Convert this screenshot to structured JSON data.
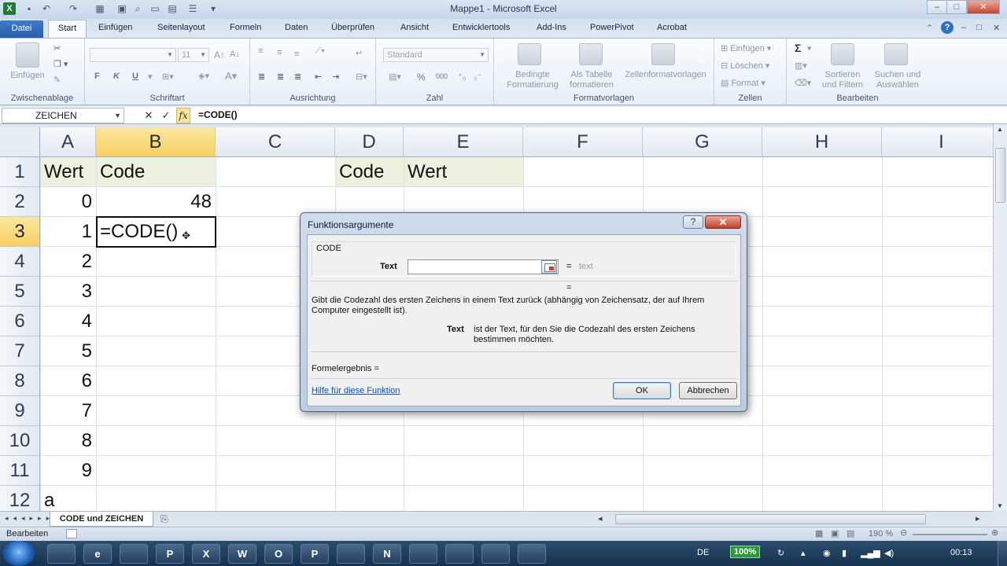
{
  "window": {
    "title": "Mappe1  -  Microsoft Excel",
    "app_icon": "X",
    "controls": {
      "minimize": "–",
      "maximize": "□",
      "close": "✕"
    }
  },
  "ribbon": {
    "tabs": [
      "Datei",
      "Start",
      "Einfügen",
      "Seitenlayout",
      "Formeln",
      "Daten",
      "Überprüfen",
      "Ansicht",
      "Entwicklertools",
      "Add-Ins",
      "PowerPivot",
      "Acrobat"
    ],
    "active_tab": "Start",
    "clipboard": {
      "paste_label": "Einfügen",
      "group_label": "Zwischenablage"
    },
    "font": {
      "font_name": "",
      "font_size": "11",
      "bold": "F",
      "italic": "K",
      "underline": "U",
      "group_label": "Schriftart"
    },
    "alignment": {
      "group_label": "Ausrichtung"
    },
    "number": {
      "format": "Standard",
      "percent": "%",
      "thousands": "000",
      "group_label": "Zahl"
    },
    "styles": {
      "conditional": [
        "Bedingte",
        "Formatierung"
      ],
      "as_table": [
        "Als Tabelle",
        "formatieren"
      ],
      "cell_styles": "Zellenformatvorlagen",
      "group_label": "Formatvorlagen"
    },
    "cells": {
      "insert": "Einfügen",
      "delete": "Löschen",
      "format": "Format",
      "group_label": "Zellen"
    },
    "editing": {
      "autosum": "Σ",
      "sort_filter": [
        "Sortieren",
        "und Filtern"
      ],
      "find_select": [
        "Suchen und",
        "Auswählen"
      ],
      "group_label": "Bearbeiten"
    }
  },
  "formula_bar": {
    "name_box": "ZEICHEN",
    "cancel": "✕",
    "enter": "✓",
    "fx": "fx",
    "formula": "=CODE()"
  },
  "grid": {
    "columns": [
      "A",
      "B",
      "C",
      "D",
      "E",
      "F",
      "G",
      "H",
      "I"
    ],
    "selected_column": "B",
    "rows": [
      "1",
      "2",
      "3",
      "4",
      "5",
      "6",
      "7",
      "8",
      "9",
      "10",
      "11",
      "12"
    ],
    "selected_row": "3",
    "cells": {
      "A1": "Wert",
      "B1": "Code",
      "D1": "Code",
      "E1": "Wert",
      "A2": "0",
      "B2": "48",
      "A3": "1",
      "B3": "=CODE()",
      "A4": "2",
      "A5": "3",
      "A6": "4",
      "A7": "5",
      "A8": "6",
      "A9": "7",
      "A10": "8",
      "A11": "9",
      "A12": "a"
    },
    "header_fill": "#ebf1de"
  },
  "sheets": {
    "active": "CODE und ZEICHEN"
  },
  "status": {
    "mode": "Bearbeiten",
    "zoom": "190 %"
  },
  "dialog": {
    "title": "Funktionsargumente",
    "help_button": "?",
    "close_button": "✕",
    "function_name": "CODE",
    "arg_label": "Text",
    "arg_value": "",
    "arg_eq": "=",
    "arg_hint": "text",
    "result_eq": "=",
    "description": "Gibt die Codezahl des ersten Zeichens in einem Text zurück (abhängig von Zeichensatz, der auf Ihrem Computer eingestellt ist).",
    "arg_desc_label": "Text",
    "arg_desc": "ist der Text, für den Sie die Codezahl des ersten Zeichens bestimmen möchten.",
    "formula_result": "Formelergebnis =",
    "help_link": "Hilfe für diese Funktion",
    "ok": "OK",
    "cancel": "Abbrechen"
  },
  "taskbar": {
    "apps": [
      "explorer-icon",
      "ie-icon",
      "firefox-icon",
      "powerpoint-icon",
      "excel-icon",
      "word-icon",
      "outlook-icon",
      "publisher-icon",
      "acrobat-icon",
      "onenote-icon",
      "snagit-icon",
      "app-icon",
      "notes-icon",
      "tool-icon"
    ],
    "app_letters": [
      "",
      "e",
      "",
      "P",
      "X",
      "W",
      "O",
      "P",
      "",
      "N",
      "",
      "",
      "",
      ""
    ],
    "language": "DE",
    "battery": "100%",
    "clock": "00:13"
  }
}
